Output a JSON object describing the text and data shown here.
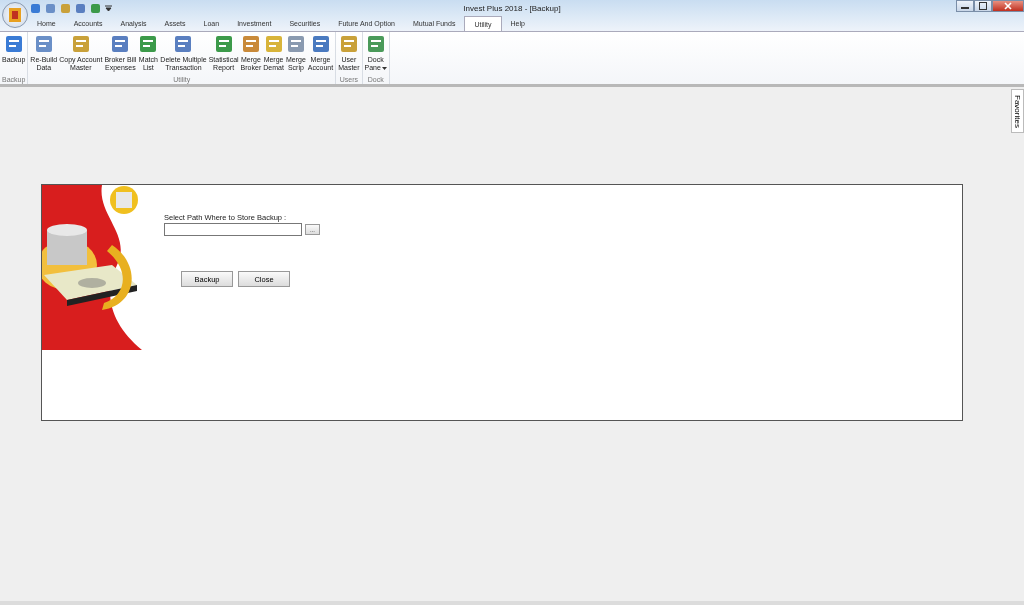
{
  "window": {
    "title": "Invest Plus 2018 - [Backup]"
  },
  "tabs": [
    {
      "label": "Home",
      "selected": false
    },
    {
      "label": "Accounts",
      "selected": false
    },
    {
      "label": "Analysis",
      "selected": false
    },
    {
      "label": "Assets",
      "selected": false
    },
    {
      "label": "Loan",
      "selected": false
    },
    {
      "label": "Investment",
      "selected": false
    },
    {
      "label": "Securities",
      "selected": false
    },
    {
      "label": "Future And Option",
      "selected": false
    },
    {
      "label": "Mutual Funds",
      "selected": false
    },
    {
      "label": "Utility",
      "selected": true
    },
    {
      "label": "Help",
      "selected": false
    }
  ],
  "ribbon_groups": [
    {
      "label": "Backup",
      "buttons": [
        {
          "lines": [
            "Backup"
          ],
          "has_menu": false
        }
      ]
    },
    {
      "label": "Utility",
      "buttons": [
        {
          "lines": [
            "Re-Build",
            "Data"
          ],
          "has_menu": false
        },
        {
          "lines": [
            "Copy Account",
            "Master"
          ],
          "has_menu": false
        },
        {
          "lines": [
            "Broker Bill",
            "Expenses"
          ],
          "has_menu": false
        },
        {
          "lines": [
            "Match",
            "List"
          ],
          "has_menu": false
        },
        {
          "lines": [
            "Delete Multiple",
            "Transaction"
          ],
          "has_menu": false
        },
        {
          "lines": [
            "Statistical",
            "Report"
          ],
          "has_menu": false
        },
        {
          "lines": [
            "Merge",
            "Broker"
          ],
          "has_menu": false
        },
        {
          "lines": [
            "Merge",
            "Demat"
          ],
          "has_menu": false
        },
        {
          "lines": [
            "Merge",
            "Scrip"
          ],
          "has_menu": false
        },
        {
          "lines": [
            "Merge",
            "Account"
          ],
          "has_menu": false
        }
      ]
    },
    {
      "label": "Users",
      "buttons": [
        {
          "lines": [
            "User",
            "Master"
          ],
          "has_menu": false
        }
      ]
    },
    {
      "label": "Dock",
      "buttons": [
        {
          "lines": [
            "Dock",
            "Pane"
          ],
          "has_menu": true
        }
      ]
    }
  ],
  "side_tab": {
    "label": "Favorites"
  },
  "dialog": {
    "path_label": "Select Path Where to Store Backup :",
    "browse_button": "...",
    "buttons": [
      "Backup",
      "Close"
    ]
  }
}
